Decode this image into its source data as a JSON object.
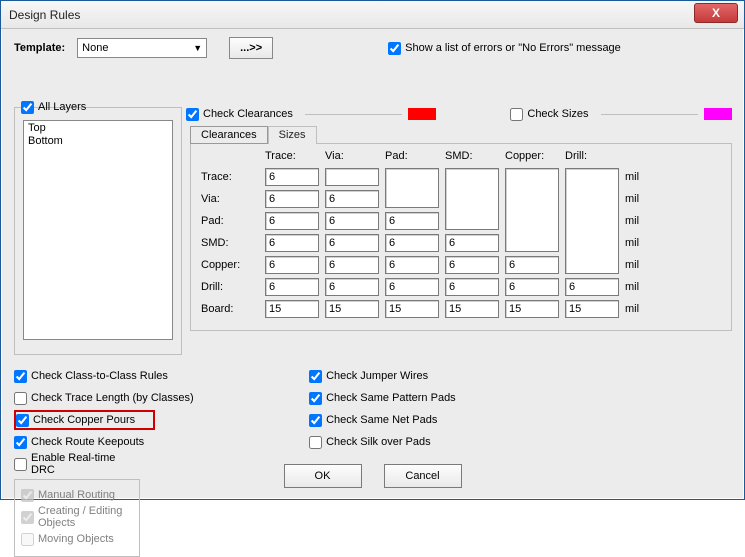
{
  "window": {
    "title": "Design Rules",
    "close_glyph": "X"
  },
  "template": {
    "label": "Template:",
    "value": "None",
    "dots_label": "...>>"
  },
  "showlist": {
    "checked": true,
    "label": "Show a list of errors or \"No Errors\" message"
  },
  "layers": {
    "all_label": "All Layers",
    "all_checked": true,
    "items": [
      "Top",
      "Bottom"
    ]
  },
  "check_clear": {
    "label": "Check Clearances",
    "checked": true,
    "swatch": "#ff0000"
  },
  "check_sizes": {
    "label": "Check Sizes",
    "checked": false,
    "swatch": "#ff00ff"
  },
  "tabs": {
    "clear": "Clearances",
    "sizes": "Sizes"
  },
  "grid": {
    "cols": [
      "Trace:",
      "Via:",
      "Pad:",
      "SMD:",
      "Copper:",
      "Drill:"
    ],
    "unit": "mil",
    "rows": [
      {
        "label": "Trace:",
        "vals": [
          "6",
          "",
          "",
          "",
          "",
          ""
        ]
      },
      {
        "label": "Via:",
        "vals": [
          "6",
          "6",
          "",
          "",
          "",
          ""
        ]
      },
      {
        "label": "Pad:",
        "vals": [
          "6",
          "6",
          "6",
          "",
          "",
          ""
        ]
      },
      {
        "label": "SMD:",
        "vals": [
          "6",
          "6",
          "6",
          "6",
          "",
          ""
        ]
      },
      {
        "label": "Copper:",
        "vals": [
          "6",
          "6",
          "6",
          "6",
          "6",
          ""
        ]
      },
      {
        "label": "Drill:",
        "vals": [
          "6",
          "6",
          "6",
          "6",
          "6",
          "6"
        ]
      },
      {
        "label": "Board:",
        "vals": [
          "15",
          "15",
          "15",
          "15",
          "15",
          "15"
        ]
      }
    ]
  },
  "bottom": {
    "col1": [
      {
        "label": "Check Class-to-Class Rules",
        "checked": true
      },
      {
        "label": "Check Trace Length (by Classes)",
        "checked": false
      },
      {
        "label": "Check Copper Pours",
        "checked": true,
        "highlight": true
      },
      {
        "label": "Check Route Keepouts",
        "checked": true
      }
    ],
    "col2": [
      {
        "label": "Check Jumper Wires",
        "checked": true
      },
      {
        "label": "Check Same Pattern Pads",
        "checked": true
      },
      {
        "label": "Check Same Net Pads",
        "checked": true
      },
      {
        "label": "Check Silk over Pads",
        "checked": false
      }
    ],
    "rt": {
      "enable_label": "Enable Real-time DRC",
      "enable_checked": false,
      "items": [
        {
          "label": "Manual Routing",
          "checked": true
        },
        {
          "label": "Creating / Editing Objects",
          "checked": true
        },
        {
          "label": "Moving Objects",
          "checked": false
        }
      ]
    }
  },
  "buttons": {
    "ok": "OK",
    "cancel": "Cancel"
  }
}
